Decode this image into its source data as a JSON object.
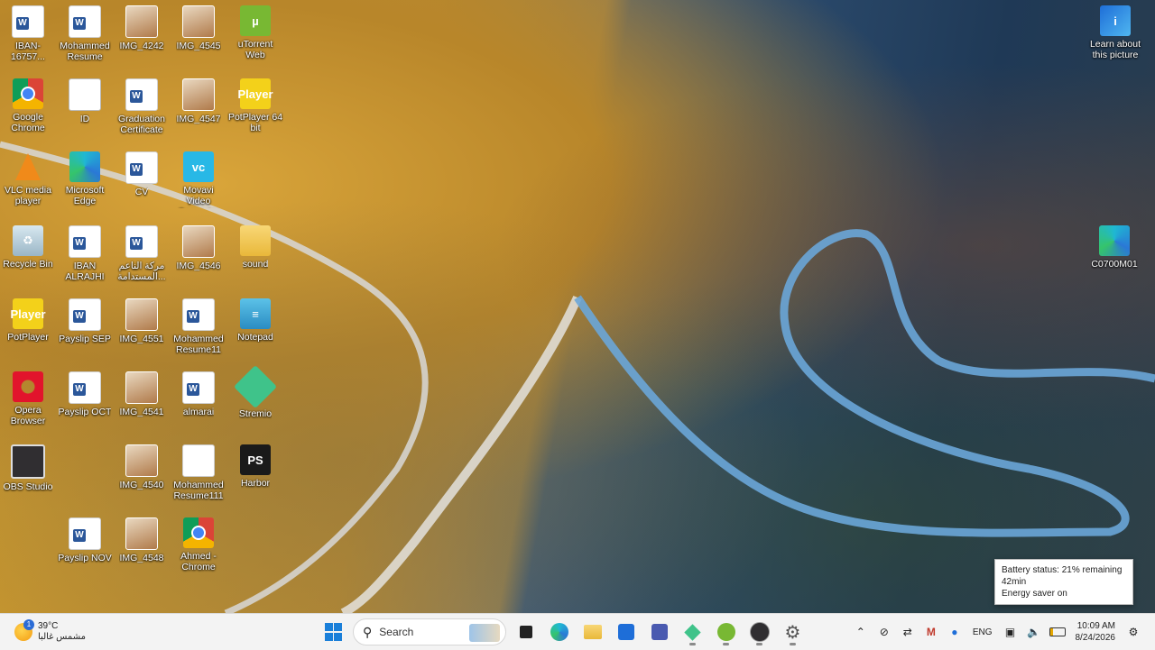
{
  "desktop": {
    "icons": [
      {
        "label": "IBAN-16757...",
        "icon": "word-doc-icon",
        "kind": "g-word"
      },
      {
        "label": "Mohammed Resume",
        "icon": "word-doc-icon",
        "kind": "g-word"
      },
      {
        "label": "IMG_4242",
        "icon": "image-file-icon",
        "kind": "g-img"
      },
      {
        "label": "IMG_4545",
        "icon": "image-file-icon",
        "kind": "g-img"
      },
      {
        "label": "uTorrent Web",
        "icon": "utorrent-icon",
        "kind": "g-utorrent",
        "glyph": "µ"
      },
      {
        "label": "Google Chrome",
        "icon": "chrome-icon",
        "kind": "g-chrome"
      },
      {
        "label": "ID",
        "icon": "id-card-icon",
        "kind": "g-id",
        "glyph": "ID"
      },
      {
        "label": "Graduation Certificate",
        "icon": "word-doc-icon",
        "kind": "g-word"
      },
      {
        "label": "IMG_4547",
        "icon": "image-file-icon",
        "kind": "g-img"
      },
      {
        "label": "PotPlayer 64 bit",
        "icon": "potplayer-icon",
        "kind": "g-potplayer",
        "glyph": "Player"
      },
      {
        "label": "VLC media player",
        "icon": "vlc-icon",
        "kind": "g-vlc"
      },
      {
        "label": "Microsoft Edge",
        "icon": "edge-icon",
        "kind": "g-edge"
      },
      {
        "label": "CV",
        "icon": "word-doc-icon",
        "kind": "g-word"
      },
      {
        "label": "Movavi Video Converter",
        "icon": "movavi-icon",
        "kind": "g-movavi",
        "glyph": "vc"
      },
      {
        "label": "Recycle Bin",
        "icon": "recycle-bin-icon",
        "kind": "g-recycle",
        "glyph": "♻"
      },
      {
        "label": "IBAN ALRAJHI",
        "icon": "word-doc-icon",
        "kind": "g-word"
      },
      {
        "label": "مركة الناعم المستدامة...",
        "icon": "word-doc-icon",
        "kind": "g-word"
      },
      {
        "label": "IMG_4546",
        "icon": "image-file-icon",
        "kind": "g-img"
      },
      {
        "label": "sound",
        "icon": "folder-icon",
        "kind": "g-folder"
      },
      {
        "label": "PotPlayer",
        "icon": "potplayer-icon",
        "kind": "g-potplayer",
        "glyph": "Player"
      },
      {
        "label": "Payslip SEP",
        "icon": "word-doc-icon",
        "kind": "g-word"
      },
      {
        "label": "IMG_4551",
        "icon": "image-file-icon",
        "kind": "g-img"
      },
      {
        "label": "Mohammed Resume11",
        "icon": "word-doc-icon",
        "kind": "g-word"
      },
      {
        "label": "Notepad",
        "icon": "notepad-icon",
        "kind": "g-notepad",
        "glyph": "≡"
      },
      {
        "label": "Opera Browser",
        "icon": "opera-icon",
        "kind": "g-opera"
      },
      {
        "label": "Payslip OCT",
        "icon": "word-doc-icon",
        "kind": "g-word"
      },
      {
        "label": "IMG_4541",
        "icon": "image-file-icon",
        "kind": "g-img"
      },
      {
        "label": "almarai",
        "icon": "word-doc-icon",
        "kind": "g-word"
      },
      {
        "label": "Stremio",
        "icon": "stremio-icon",
        "kind": "g-stremio"
      },
      {
        "label": "OBS Studio",
        "icon": "obs-icon",
        "kind": "g-obs"
      },
      {
        "label": "IMG_4540",
        "icon": "image-file-icon",
        "kind": "g-img"
      },
      {
        "label": "Mohammed Resume111",
        "icon": "blank-doc-icon",
        "kind": "g-blank"
      },
      {
        "label": "Harbor",
        "icon": "harbor-icon",
        "kind": "g-harbor",
        "glyph": "PS"
      },
      {
        "label": "Payslip NOV",
        "icon": "word-doc-icon",
        "kind": "g-word"
      },
      {
        "label": "IMG_4548",
        "icon": "image-file-icon",
        "kind": "g-img"
      },
      {
        "label": "Ahmed - Chrome",
        "icon": "chrome-icon",
        "kind": "g-chrome"
      },
      {
        "label": "Learn about this picture",
        "icon": "learn-picture-icon",
        "kind": "g-learn",
        "glyph": "i"
      },
      {
        "label": "C0700M01",
        "icon": "edge-icon",
        "kind": "g-edge"
      }
    ]
  },
  "battery_tooltip": {
    "line1": "Battery status: 21% remaining",
    "line2": "42min",
    "line3": "Energy saver on"
  },
  "taskbar": {
    "weather": {
      "temp": "39°C",
      "condition": "مشمس غالبا",
      "badge": "1"
    },
    "search": {
      "label": "Search"
    },
    "tray": {
      "language": "ENG",
      "time": "10:09 AM",
      "date": "8/24/2026"
    }
  }
}
